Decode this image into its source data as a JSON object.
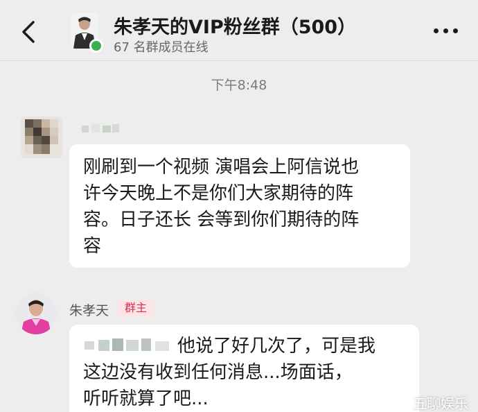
{
  "header": {
    "back_icon": "chevron-left-icon",
    "group_title": "朱孝天的VIP粉丝群（500）",
    "online_status": "67 名群成员在线",
    "more_icon": "more-horizontal-icon",
    "online_color": "#38b24a"
  },
  "chat": {
    "timestamp": "下午8:48",
    "messages": [
      {
        "sender": "",
        "lines": [
          "刚刷到一个视频 演唱会上阿信说也",
          "许今天晚上不是你们大家期待的阵",
          "容。日子还长 会等到你们期待的阵",
          "容"
        ]
      },
      {
        "sender": "朱孝天",
        "role": "群主",
        "lines": [
          "他说了好几次了，可是我",
          "这边没有收到任何消息...场面话，",
          "听听就算了吧..."
        ]
      }
    ]
  },
  "watermark": "五聊娱乐",
  "colors": {
    "background": "#ededed",
    "bubble": "#ffffff",
    "badge_text": "#d9304d",
    "badge_bg": "#fde4e7"
  }
}
